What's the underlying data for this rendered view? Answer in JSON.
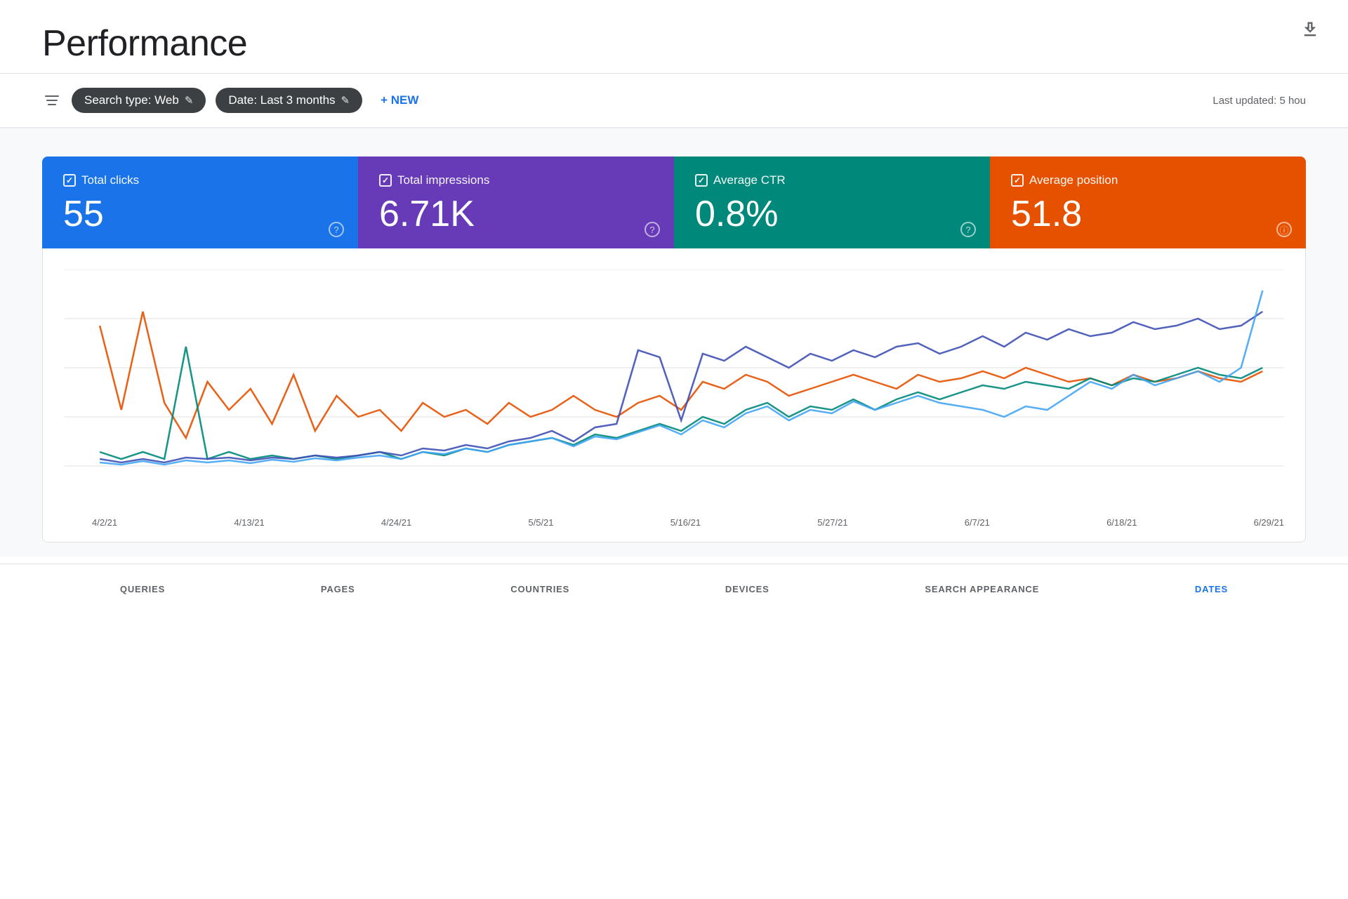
{
  "page": {
    "title": "Performance"
  },
  "toolbar": {
    "search_type_label": "Search type: Web",
    "date_label": "Date: Last 3 months",
    "new_button_label": "+ NEW",
    "last_updated": "Last updated: 5 hou",
    "edit_icon": "✎"
  },
  "metrics": [
    {
      "id": "clicks",
      "label": "Total clicks",
      "value": "55",
      "color": "#1a73e8"
    },
    {
      "id": "impressions",
      "label": "Total impressions",
      "value": "6.71K",
      "color": "#673ab7"
    },
    {
      "id": "ctr",
      "label": "Average CTR",
      "value": "0.8%",
      "color": "#00897b"
    },
    {
      "id": "position",
      "label": "Average position",
      "value": "51.8",
      "color": "#e65100"
    }
  ],
  "chart": {
    "x_labels": [
      "4/2/21",
      "4/13/21",
      "4/24/21",
      "5/5/21",
      "5/16/21",
      "5/27/21",
      "6/7/21",
      "6/18/21",
      "6/29/21"
    ]
  },
  "bottom_tabs": {
    "items": [
      "QUERIES",
      "PAGES",
      "COUNTRIES",
      "DEVICES",
      "SEARCH APPEARANCE",
      "DATES"
    ]
  }
}
